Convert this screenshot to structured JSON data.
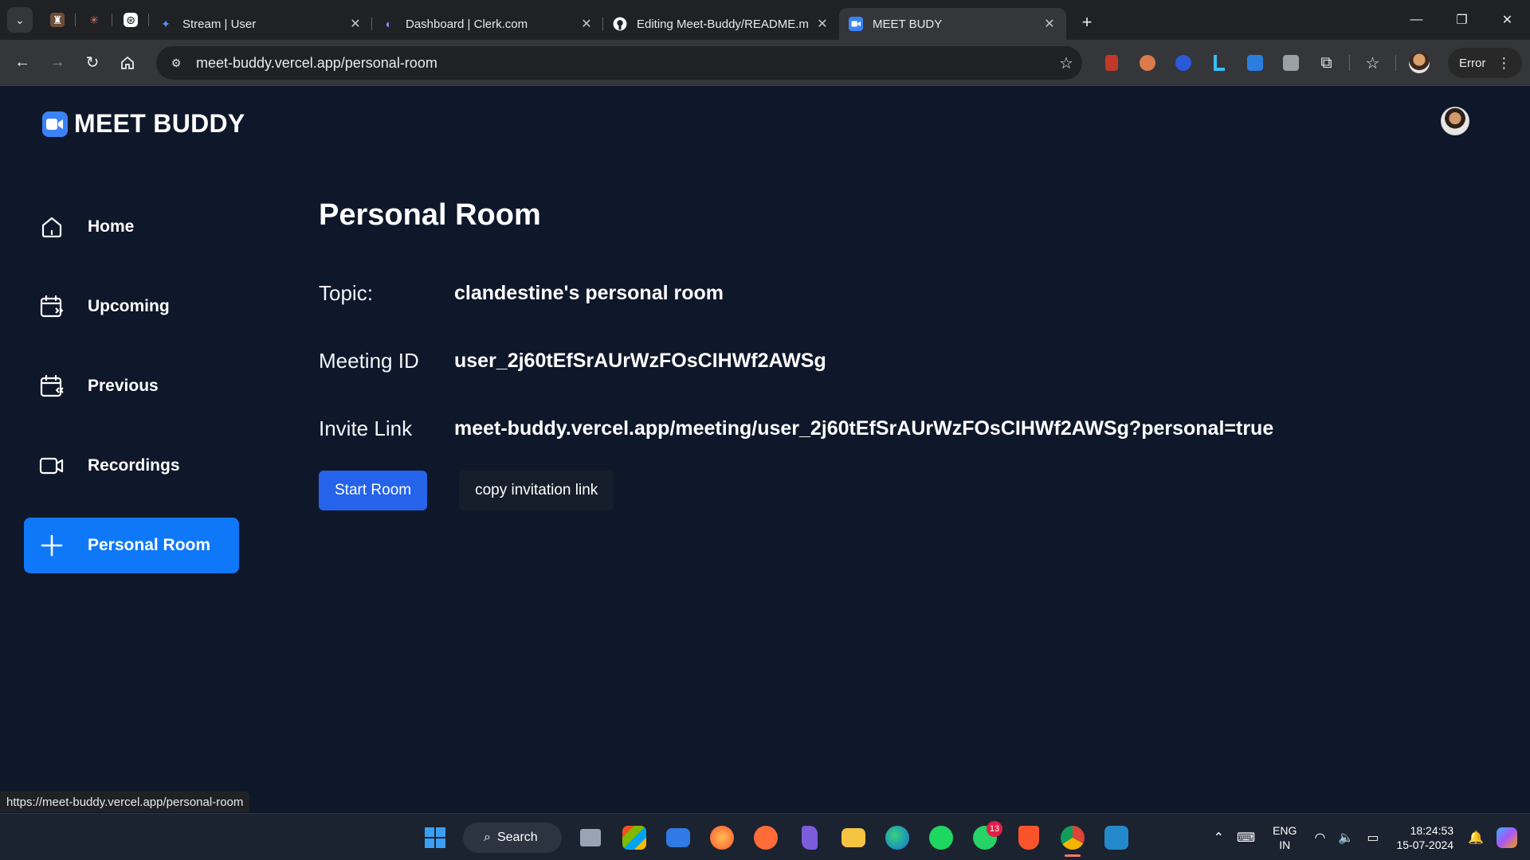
{
  "browser": {
    "tabs": [
      {
        "title": "Stream | User",
        "icon": "stream-icon"
      },
      {
        "title": "Dashboard | Clerk.com",
        "icon": "clerk-icon"
      },
      {
        "title": "Editing Meet-Buddy/README.m",
        "icon": "github-icon"
      },
      {
        "title": "MEET BUDY",
        "icon": "meet-buddy-icon"
      }
    ],
    "url": "meet-buddy.vercel.app/personal-room",
    "error_label": "Error",
    "status_url": "https://meet-buddy.vercel.app/personal-room"
  },
  "app": {
    "logo_text": "MEET BUDDY",
    "nav": [
      {
        "label": "Home",
        "icon": "home-icon"
      },
      {
        "label": "Upcoming",
        "icon": "calendar-upcoming-icon"
      },
      {
        "label": "Previous",
        "icon": "calendar-previous-icon"
      },
      {
        "label": "Recordings",
        "icon": "video-icon"
      },
      {
        "label": "Personal Room",
        "icon": "plus-icon",
        "active": true
      }
    ],
    "page_title": "Personal Room",
    "info": {
      "topic_label": "Topic:",
      "topic_value": "clandestine's personal room",
      "meeting_id_label": "Meeting ID",
      "meeting_id_value": "user_2j60tEfSrAUrWzFOsCIHWf2AWSg",
      "invite_label": "Invite Link",
      "invite_value": "meet-buddy.vercel.app/meeting/user_2j60tEfSrAUrWzFOsCIHWf2AWSg?personal=true"
    },
    "buttons": {
      "start": "Start Room",
      "copy": "copy invitation link"
    },
    "accent_color": "#0e78f9",
    "background_color": "#0f172a"
  },
  "taskbar": {
    "search_label": "Search",
    "whatsapp_badge": "13",
    "lang_line1": "ENG",
    "lang_line2": "IN",
    "time": "18:24:53",
    "date": "15-07-2024"
  }
}
